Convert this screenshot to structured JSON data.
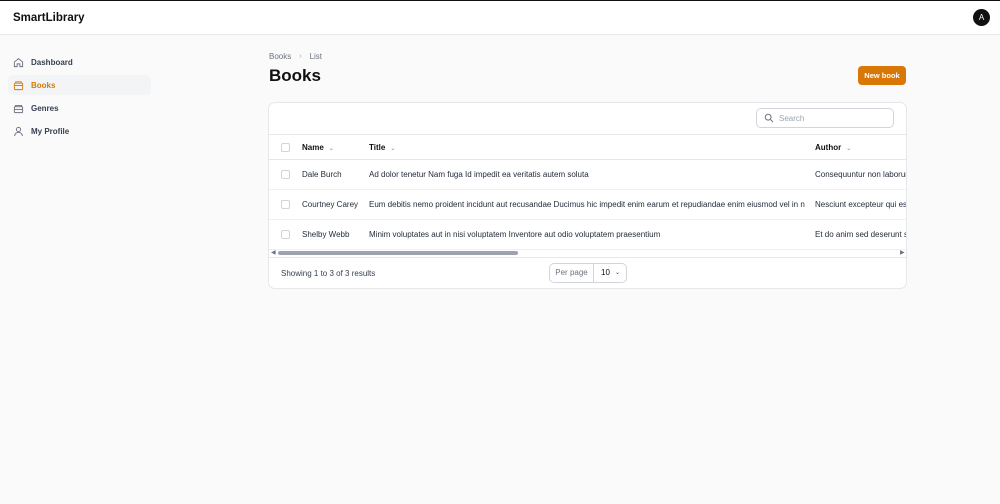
{
  "app": {
    "title": "SmartLibrary",
    "avatar_initial": "A"
  },
  "sidebar": {
    "items": [
      {
        "label": "Dashboard",
        "icon": "home-icon",
        "active": false
      },
      {
        "label": "Books",
        "icon": "book-icon",
        "active": true
      },
      {
        "label": "Genres",
        "icon": "layers-icon",
        "active": false
      },
      {
        "label": "My Profile",
        "icon": "user-icon",
        "active": false
      }
    ]
  },
  "breadcrumb": {
    "items": [
      "Books",
      "List"
    ],
    "separator": "›"
  },
  "page": {
    "title": "Books",
    "new_button": "New book"
  },
  "search": {
    "placeholder": "Search",
    "value": ""
  },
  "table": {
    "columns": [
      {
        "label": "Name",
        "sortable": true
      },
      {
        "label": "Title",
        "sortable": true
      },
      {
        "label": "Author",
        "sortable": true
      }
    ],
    "rows": [
      {
        "name": "Dale Burch",
        "title": "Ad dolor tenetur Nam fuga Id impedit ea veritatis autem soluta",
        "author": "Consequuntur non laborum"
      },
      {
        "name": "Courtney Carey",
        "title": "Eum debitis nemo proident incidunt aut recusandae Ducimus hic impedit enim earum et repudiandae enim eiusmod vel in non",
        "author": "Nesciunt excepteur qui est"
      },
      {
        "name": "Shelby Webb",
        "title": "Minim voluptates aut in nisi voluptatem Inventore aut odio voluptatem praesentium",
        "author": "Et do anim sed deserunt sed"
      }
    ]
  },
  "pagination": {
    "results_text": "Showing 1 to 3 of 3 results",
    "per_page_label": "Per page",
    "per_page_value": "10"
  },
  "colors": {
    "accent": "#d97706",
    "active_bg": "#f3f4f6"
  }
}
